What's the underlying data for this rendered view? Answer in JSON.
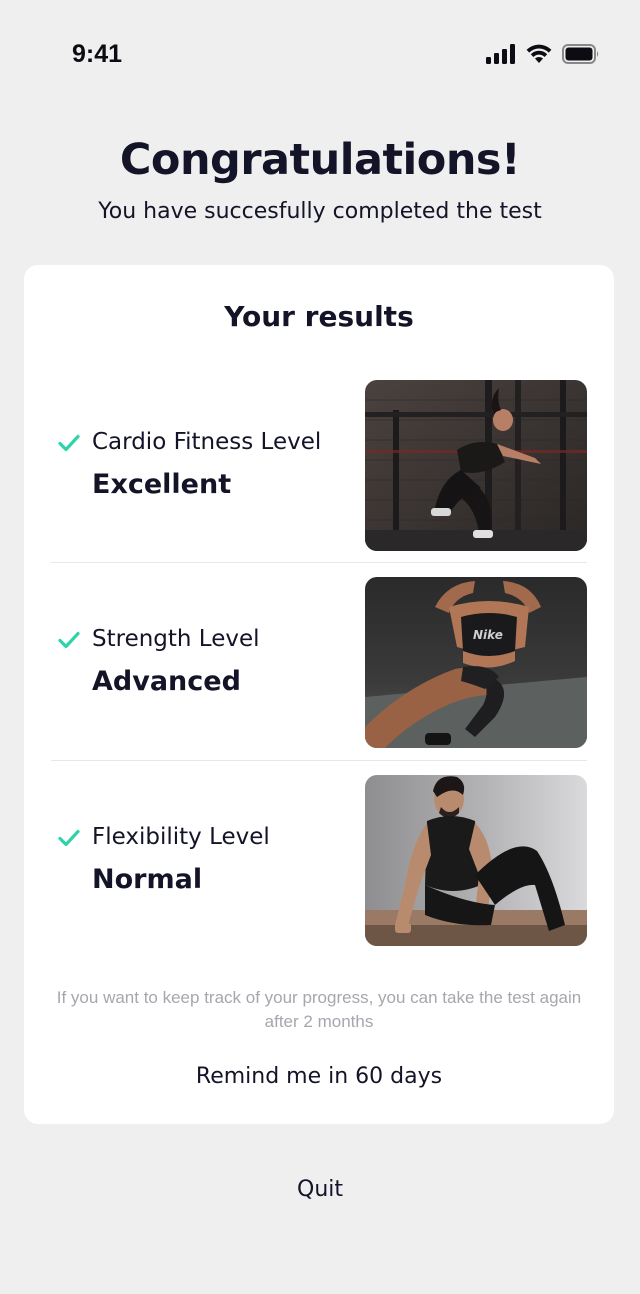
{
  "status_bar": {
    "time": "9:41",
    "icons": [
      "signal-icon",
      "wifi-icon",
      "battery-icon"
    ]
  },
  "header": {
    "title": "Congratulations!",
    "subtitle": "You have succesfully completed the test"
  },
  "results": {
    "title": "Your results",
    "items": [
      {
        "label": "Cardio Fitness Level",
        "value": "Excellent",
        "icon": "check-icon",
        "photo": "woman-jump-squat-photo"
      },
      {
        "label": "Strength Level",
        "value": "Advanced",
        "icon": "check-icon",
        "photo": "woman-situp-photo"
      },
      {
        "label": "Flexibility Level",
        "value": "Normal",
        "icon": "check-icon",
        "photo": "man-stretching-photo"
      }
    ],
    "note": "If you want to keep track of your progress, you can take the test again after 2 months",
    "remind_label": "Remind me in 60 days"
  },
  "footer": {
    "quit_label": "Quit"
  },
  "colors": {
    "background": "#efefef",
    "card": "#ffffff",
    "text": "#141428",
    "check": "#2ed3a8",
    "muted": "#a6a6ae"
  }
}
